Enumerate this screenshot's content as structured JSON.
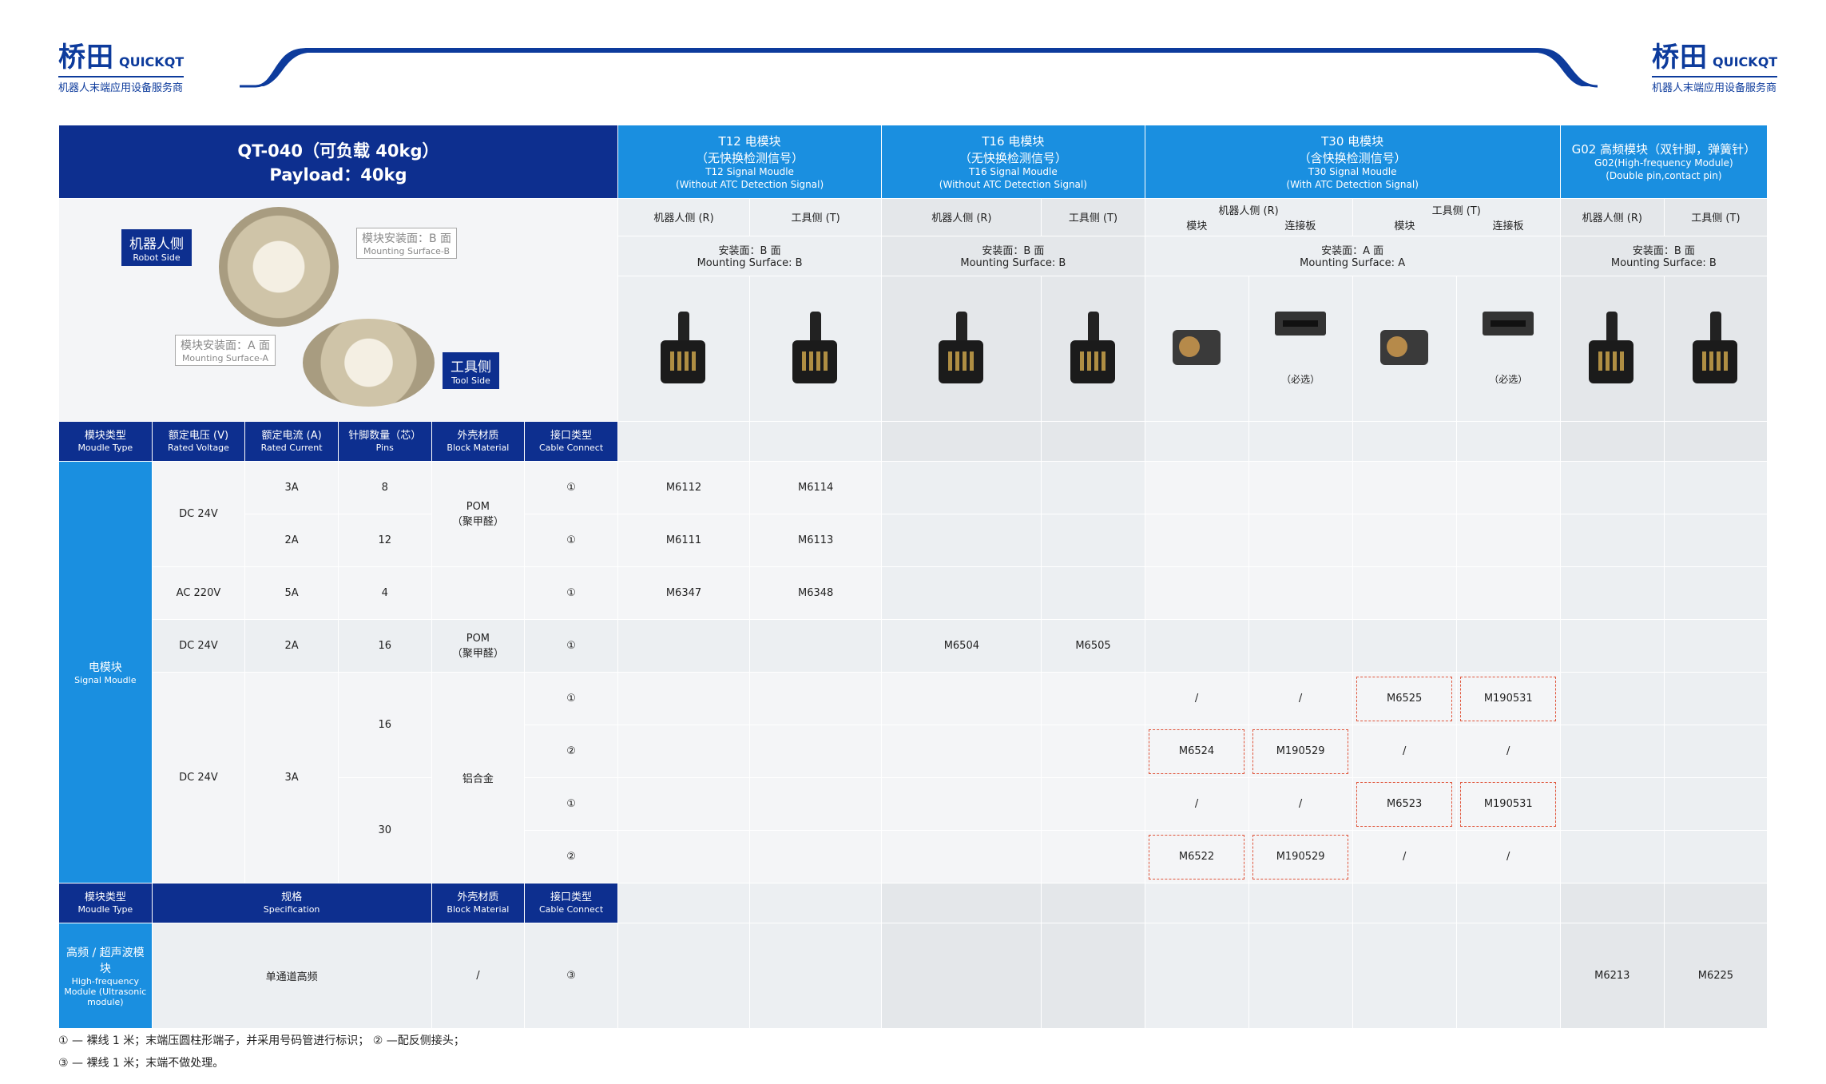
{
  "brand": {
    "name_cn": "桥田",
    "name_en": "QUICKQT",
    "tagline": "机器人末端应用设备服务商"
  },
  "title": {
    "line1": "QT-040（可负载 40kg）",
    "line2": "Payload：40kg"
  },
  "groups": [
    {
      "cn": "T12 电模块",
      "sub_cn": "（无快换检测信号）",
      "en": "T12 Signal Moudle",
      "sub_en": "(Without ATC Detection Signal)"
    },
    {
      "cn": "T16 电模块",
      "sub_cn": "（无快换检测信号）",
      "en": "T16 Signal Moudle",
      "sub_en": "(Without ATC Detection Signal)"
    },
    {
      "cn": "T30 电模块",
      "sub_cn": "（含快换检测信号）",
      "en": "T30 Signal Moudle",
      "sub_en": "(With ATC Detection Signal)"
    },
    {
      "cn": "G02 高频模块（双针脚，弹簧针）",
      "en": "G02(High-frequency Module)",
      "sub_en": "(Double pin,contact pin)"
    }
  ],
  "side": {
    "robot": "机器人侧 (R)",
    "tool": "工具侧 (T)",
    "module": "模块",
    "plate": "连接板",
    "optional": "（必选）"
  },
  "mount": {
    "b_cn": "安装面：B 面",
    "b_en": "Mounting Surface: B",
    "a_cn": "安装面：A 面",
    "a_en": "Mounting Surface: A"
  },
  "product_image": {
    "robot_side_cn": "机器人侧",
    "robot_side_en": "Robot Side",
    "tool_side_cn": "工具侧",
    "tool_side_en": "Tool Side",
    "surf_b_cn": "模块安装面：B 面",
    "surf_b_en": "Mounting Surface-B",
    "surf_a_cn": "模块安装面：A 面",
    "surf_a_en": "Mounting Surface-A"
  },
  "cols": {
    "type": {
      "cn": "模块类型",
      "en": "Moudle Type"
    },
    "voltage": {
      "cn": "额定电压 (V)",
      "en": "Rated Voltage"
    },
    "current": {
      "cn": "额定电流 (A)",
      "en": "Rated Current"
    },
    "pins": {
      "cn": "针脚数量（芯）",
      "en": "Pins"
    },
    "material": {
      "cn": "外壳材质",
      "en": "Block Material"
    },
    "cable": {
      "cn": "接口类型",
      "en": "Cable Connect"
    },
    "spec": {
      "cn": "规格",
      "en": "Specification"
    }
  },
  "signal_label": {
    "cn": "电模块",
    "en": "Signal Moudle"
  },
  "hf_label": {
    "cn": "高频 / 超声波模块",
    "en": "High-frequency Module (Ultrasonic module)"
  },
  "rows": {
    "dc24": "DC 24V",
    "ac220": "AC 220V",
    "a3": "3A",
    "a2": "2A",
    "a5": "5A",
    "p8": "8",
    "p12": "12",
    "p4": "4",
    "p16": "16",
    "p30": "30",
    "pom": "POM",
    "pom_cn": "（聚甲醛）",
    "al": "铝合金",
    "c1": "①",
    "c2": "②",
    "c3": "③",
    "m6112": "M6112",
    "m6114": "M6114",
    "m6111": "M6111",
    "m6113": "M6113",
    "m6347": "M6347",
    "m6348": "M6348",
    "m6504": "M6504",
    "m6505": "M6505",
    "m6525": "M6525",
    "m190531": "M190531",
    "m6524": "M6524",
    "m190529": "M190529",
    "m6523": "M6523",
    "m6522": "M6522",
    "slash": "/",
    "hf_spec": "单通道高频",
    "m6213": "M6213",
    "m6225": "M6225"
  },
  "notes": {
    "n1": "① — 裸线 1 米；末端压圆柱形端子，并采用号码管进行标识；  ② —配反侧接头；",
    "n2": "③ — 裸线 1 米；末端不做处理。"
  }
}
